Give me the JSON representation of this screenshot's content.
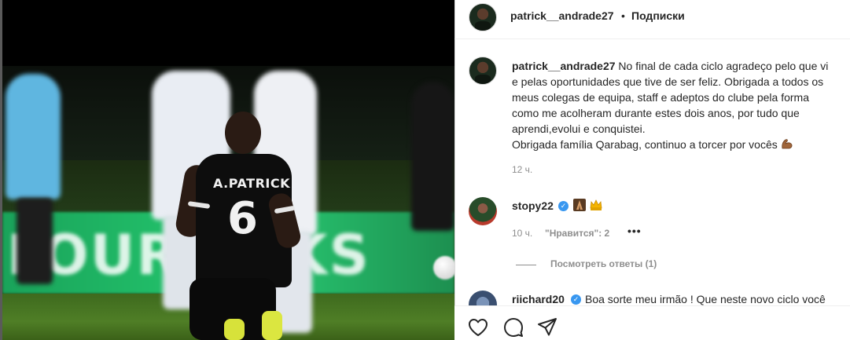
{
  "post": {
    "author": "patrick__andrade27",
    "separator": "•",
    "follow_label": "Подписки",
    "caption_lines": [
      "No final de cada ciclo agradeço pelo que vi",
      "e pelas oportunidades que tive de ser feliz. Obrigada a todos os",
      "meus colegas de equipa, staff e adeptos do clube pela forma",
      "como me acolheram durante estes dois anos, por tudo que",
      "aprendi,evolui e conquistei.",
      "Obrigada família Qarabag, continuo a torcer por vocês"
    ],
    "caption_emoji": "flexed-biceps-emoji",
    "time": "12 ч."
  },
  "photo": {
    "jersey_name": "A.PATRICK",
    "jersey_number": "6",
    "board_text": "LOUR KCKS"
  },
  "comments": [
    {
      "user": "stopy22",
      "verified": true,
      "emojis": [
        "praying-emoji",
        "crown-emoji"
      ],
      "time": "10 ч.",
      "likes": "\"Нравится\": 2",
      "more": "•••",
      "replies": "Посмотреть ответы (1)"
    },
    {
      "user": "riichard20",
      "verified": true,
      "text": "Boa sorte meu irmão ! Que neste novo ciclo você"
    }
  ],
  "actions": {
    "icons": [
      "heart-icon",
      "comment-icon",
      "share-icon"
    ]
  },
  "colors": {
    "text": "#262626",
    "muted": "#8e8e8e",
    "verified": "#3897f0",
    "border": "#dbdbdb"
  }
}
